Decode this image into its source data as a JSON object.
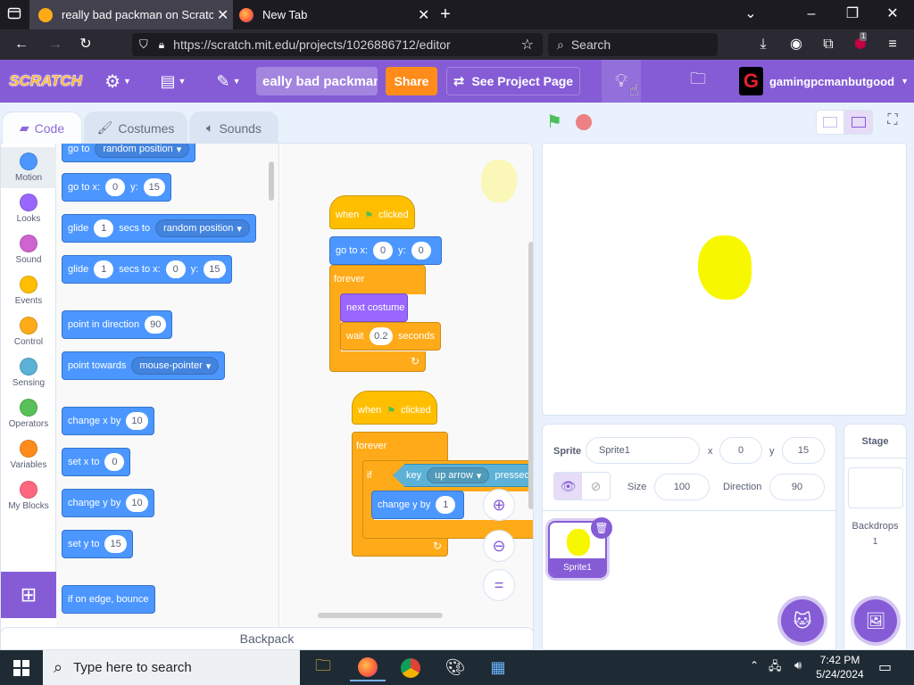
{
  "browser": {
    "tabs": [
      {
        "title": "really bad packman on Scratch",
        "active": true
      },
      {
        "title": "New Tab",
        "active": false
      }
    ],
    "url": "https://scratch.mit.edu/projects/1026886712/editor",
    "search_placeholder": "Search",
    "badge_count": "1"
  },
  "menu": {
    "logo": "SCRATCH",
    "project_title": "eally bad packman",
    "share_label": "Share",
    "see_project_label": "See Project Page",
    "username": "gamingpcmanbutgood",
    "brand_color": "#855cd6"
  },
  "editor_tabs": [
    {
      "label": "Code",
      "icon": "code-icon"
    },
    {
      "label": "Costumes",
      "icon": "brush-icon"
    },
    {
      "label": "Sounds",
      "icon": "speaker-icon"
    }
  ],
  "categories": [
    {
      "label": "Motion",
      "color": "#4c97ff"
    },
    {
      "label": "Looks",
      "color": "#9966ff"
    },
    {
      "label": "Sound",
      "color": "#cf63cf"
    },
    {
      "label": "Events",
      "color": "#ffbf00"
    },
    {
      "label": "Control",
      "color": "#ffab19"
    },
    {
      "label": "Sensing",
      "color": "#5cb1d6"
    },
    {
      "label": "Operators",
      "color": "#59c059"
    },
    {
      "label": "Variables",
      "color": "#ff8c1a"
    },
    {
      "label": "My Blocks",
      "color": "#ff6680"
    }
  ],
  "palette": {
    "goto_random": {
      "text": "go to",
      "drop": "random position"
    },
    "goto_xy": {
      "text": "go to x:",
      "x": "0",
      "y_label": "y:",
      "y": "15"
    },
    "glide_random": {
      "text": "glide",
      "secs": "1",
      "secs_label": "secs to",
      "drop": "random position"
    },
    "glide_xy": {
      "text": "glide",
      "secs": "1",
      "secs_label": "secs to x:",
      "x": "0",
      "y_label": "y:",
      "y": "15"
    },
    "point_dir": {
      "text": "point in direction",
      "val": "90"
    },
    "point_towards": {
      "text": "point towards",
      "drop": "mouse-pointer"
    },
    "change_x": {
      "text": "change x by",
      "val": "10"
    },
    "set_x": {
      "text": "set x to",
      "val": "0"
    },
    "change_y": {
      "text": "change y by",
      "val": "10"
    },
    "set_y": {
      "text": "set y to",
      "val": "15"
    },
    "bounce": {
      "text": "if on edge, bounce"
    }
  },
  "script1": {
    "when": "when",
    "clicked": "clicked",
    "goto": "go to x:",
    "x": "0",
    "y_label": "y:",
    "y": "0",
    "forever": "forever",
    "next_costume": "next costume",
    "wait": "wait",
    "wait_val": "0.2",
    "seconds": "seconds"
  },
  "script2": {
    "when": "when",
    "clicked": "clicked",
    "forever": "forever",
    "if": "if",
    "key": "key",
    "key_drop": "up arrow",
    "pressed": "pressed",
    "change_y": "change y by",
    "change_y_val": "1"
  },
  "backpack_label": "Backpack",
  "sprite_info": {
    "sprite_label": "Sprite",
    "sprite_name": "Sprite1",
    "x_label": "x",
    "x": "0",
    "y_label": "y",
    "y": "15",
    "show_label": "Show",
    "size_label": "Size",
    "size": "100",
    "direction_label": "Direction",
    "direction": "90"
  },
  "sprites": [
    {
      "name": "Sprite1"
    }
  ],
  "stage_panel": {
    "title": "Stage",
    "backdrops_label": "Backdrops",
    "backdrops_count": "1"
  },
  "taskbar": {
    "search_placeholder": "Type here to search",
    "time": "7:42 PM",
    "date": "5/24/2024"
  }
}
